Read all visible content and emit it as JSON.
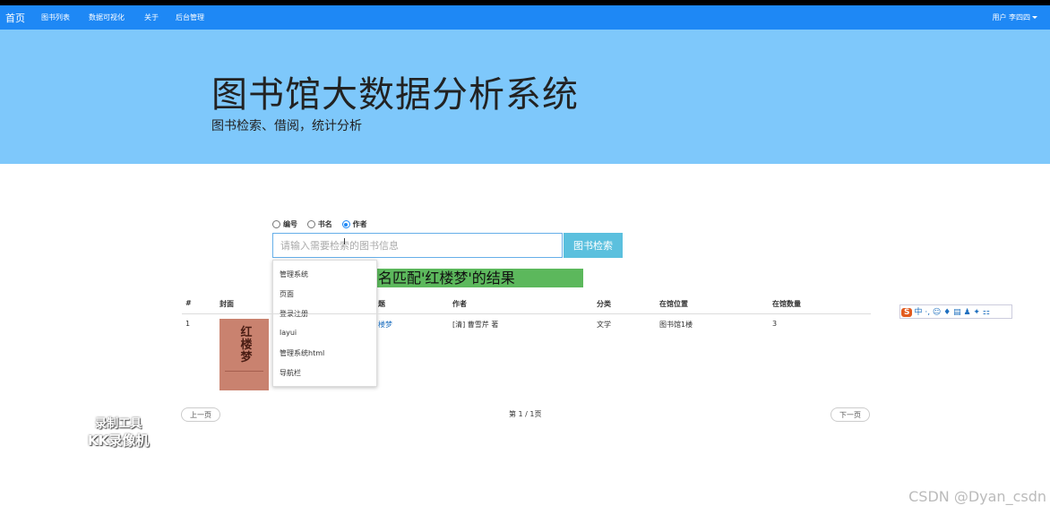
{
  "navbar": {
    "brand": "首页",
    "items": [
      "图书列表",
      "数据可视化",
      "关于",
      "后台管理"
    ],
    "user": "用户 李四四"
  },
  "hero": {
    "title": "图书馆大数据分析系统",
    "subtitle": "图书检索、借阅，统计分析"
  },
  "search": {
    "radios": [
      {
        "label": "编号",
        "checked": false
      },
      {
        "label": "书名",
        "checked": false
      },
      {
        "label": "作者",
        "checked": true
      }
    ],
    "placeholder": "请输入需要检索的图书信息",
    "button": "图书检索",
    "suggestions": [
      "管理系统",
      "页面",
      "登录注册",
      "layui",
      "管理系统html",
      "导航栏"
    ]
  },
  "result_banner": "名匹配'红楼梦'的结果",
  "table": {
    "headers": [
      "#",
      "封面",
      "题",
      "作者",
      "分类",
      "在馆位置",
      "在馆数量"
    ],
    "rows": [
      {
        "index": "1",
        "title": "楼梦",
        "author": "[清] 曹雪芹 著",
        "category": "文学",
        "location": "图书馆1楼",
        "count": "3",
        "cover_text": "红楼梦"
      }
    ]
  },
  "pager": {
    "prev": "上一页",
    "info": "第 1 / 1页",
    "next": "下一页"
  },
  "overlay": {
    "watermark_line1": "录制工具",
    "watermark_line2": "KK录像机",
    "ime": "中 ·, ☺ ♦ ▤ ♟ ✦ ⚏",
    "csdn": "CSDN @Dyan_csdn"
  },
  "colors": {
    "navbar": "#1e88f5",
    "hero": "#7ec8fb",
    "search_button": "#5bc0de",
    "banner": "#5cb85c"
  }
}
